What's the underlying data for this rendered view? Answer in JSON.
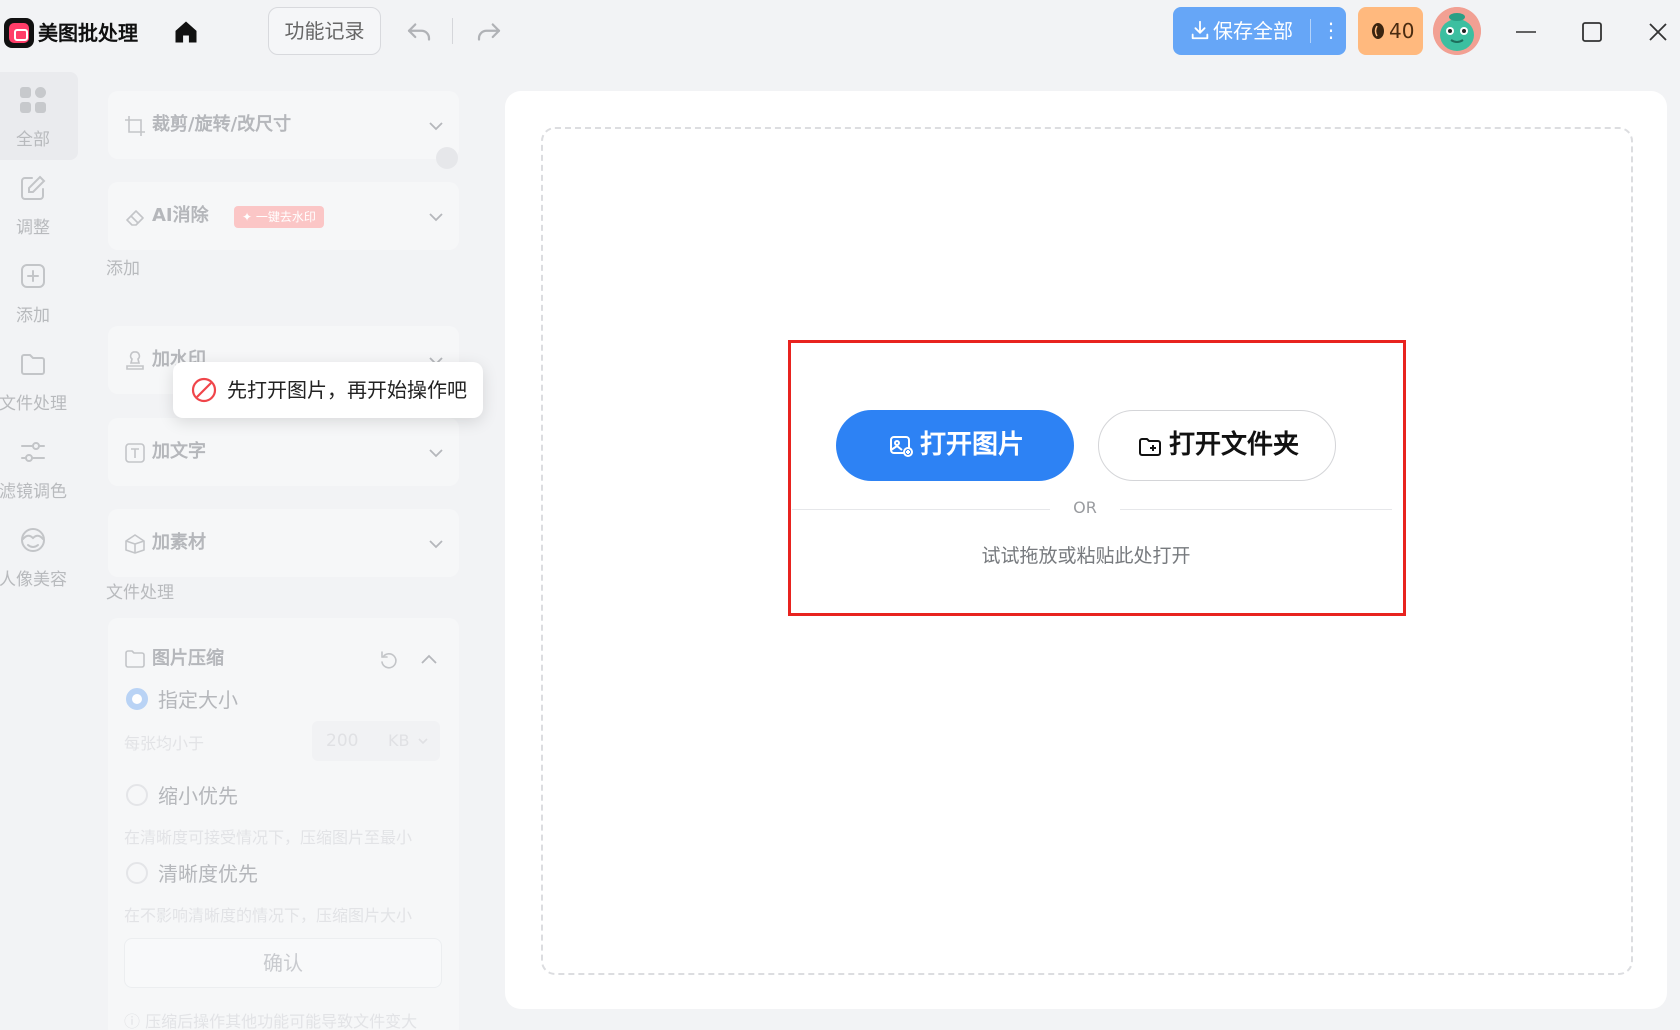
{
  "app": {
    "title": "美图批处理"
  },
  "toolbar": {
    "history_label": "功能记录",
    "save_all_label": "保存全部",
    "save_more": "⋮",
    "credits": "40"
  },
  "nav": {
    "items": [
      {
        "label": "全部",
        "icon": "grid-icon",
        "active": true
      },
      {
        "label": "调整",
        "icon": "edit-icon"
      },
      {
        "label": "添加",
        "icon": "add-square-icon"
      },
      {
        "label": "文件处理",
        "icon": "folder-icon"
      },
      {
        "label": "滤镜调色",
        "icon": "sliders-icon"
      },
      {
        "label": "人像美容",
        "icon": "face-icon"
      }
    ]
  },
  "panel": {
    "crop_label": "裁剪/旋转/改尺寸",
    "ai_erase_label": "AI消除",
    "ai_erase_badge": "✦ 一键去水印",
    "section_add": "添加",
    "watermark_label": "加水印",
    "text_label": "加文字",
    "material_label": "加素材",
    "section_file": "文件处理",
    "compress": {
      "title": "图片压缩",
      "opt1_label": "指定大小",
      "opt1_desc": "每张均小于",
      "size_value": "200",
      "size_unit": "KB",
      "opt2_label": "缩小优先",
      "opt2_desc": "在清晰度可接受情况下，压缩图片至最小",
      "opt3_label": "清晰度优先",
      "opt3_desc": "在不影响清晰度的情况下，压缩图片大小",
      "confirm_label": "确认",
      "note": "ⓘ 压缩后操作其他功能可能导致文件变大"
    }
  },
  "toast": {
    "message": "先打开图片，再开始操作吧"
  },
  "canvas": {
    "open_image_label": "打开图片",
    "open_folder_label": "打开文件夹",
    "or_text": "OR",
    "drag_hint": "试试拖放或粘贴此处打开"
  },
  "colors": {
    "primary": "#2d82f4",
    "save_button": "#66a6f7",
    "credits_bg": "#ffb97e",
    "highlight_border": "#e8231f",
    "toast_icon": "#f0454a"
  }
}
